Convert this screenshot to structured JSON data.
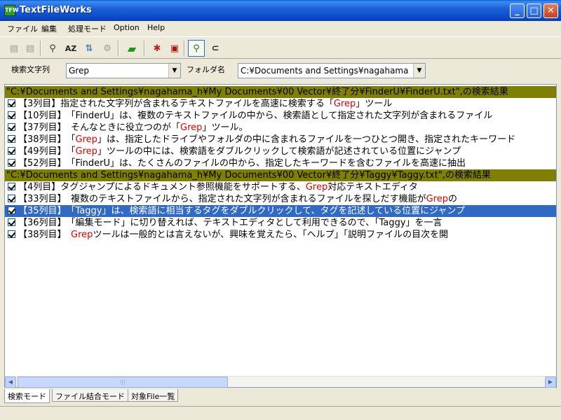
{
  "window": {
    "title": "TextFileWorks",
    "app_icon_text": "TFW",
    "minimize_label": "_",
    "maximize_label": "□",
    "close_label": "✕"
  },
  "menu": [
    "ファイル",
    "編集",
    "処理モード",
    "Option",
    "Help"
  ],
  "toolbar": {
    "icons": [
      "new-file-icon",
      "save-icon",
      "search-person-icon",
      "sort-az-icon",
      "replace-icon",
      "settings-icon",
      "open-folder-icon",
      "color-mark-icon",
      "red-mark-icon",
      "grep-search-icon",
      "paperclip-icon"
    ],
    "az_label": "AZ"
  },
  "search": {
    "label": "検索文字列",
    "value": "Grep",
    "folder_label": "フォルダ名",
    "folder_value": "C:¥Documents and Settings¥nagahama"
  },
  "results": [
    {
      "type": "file",
      "text": "\"C:¥Documents and Settings¥nagahama_h¥My Documents¥00 Vector¥終了分¥FinderU¥FinderU.txt\",の検索結果"
    },
    {
      "type": "match",
      "pre": "【3列目】指定された文字列が含まれるテキストファイルを高速に検索する「",
      "hit": "Grep",
      "post": "」ツール"
    },
    {
      "type": "match",
      "pre": "【10列目】　「FinderU」は、複数のテキストファイルの中から、検索語として指定された文字列が含まれるファイル",
      "hit": "",
      "post": ""
    },
    {
      "type": "match",
      "pre": "【37列目】　そんなときに役立つのが「",
      "hit": "Grep",
      "post": "」ツール。"
    },
    {
      "type": "match",
      "pre": "【38列目】　「",
      "hit": "Grep",
      "post": "」は、指定したドライブやフォルダの中に含まれるファイルを一つひとつ開き、指定されたキーワード"
    },
    {
      "type": "match",
      "pre": "【49列目】　「",
      "hit": "Grep",
      "post": "」ツールの中には、検索語をダブルクリックして検索語が記述されている位置にジャンプ"
    },
    {
      "type": "match",
      "pre": "【52列目】　「FinderU」は、たくさんのファイルの中から、指定したキーワードを含むファイルを高速に抽出",
      "hit": "",
      "post": ""
    },
    {
      "type": "file",
      "text": "\"C:¥Documents and Settings¥nagahama_h¥My Documents¥00 Vector¥終了分¥Taggy¥Taggy.txt\",の検索結果"
    },
    {
      "type": "match",
      "pre": "【4列目】タグジャンプによるドキュメント参照機能をサポートする、",
      "hit": "Grep",
      "post": "対応テキストエディタ"
    },
    {
      "type": "match",
      "pre": "【33列目】　複数のテキストファイルから、指定された文字列が含まれるファイルを探しだす機能が",
      "hit": "Grep",
      "post": "の"
    },
    {
      "type": "match",
      "selected": true,
      "pre": "【35列目】　「Taggy」は、検索語に相当するタグをダブルクリックして、タグを記述している位置にジャンプ",
      "hit": "",
      "post": ""
    },
    {
      "type": "match",
      "pre": "【36列目】　「編集モード」に切り替えれば、テキストエディタとして利用できるので、「Taggy」を一言",
      "hit": "",
      "post": ""
    },
    {
      "type": "match",
      "pre": "【38列目】　",
      "hit": "Grep",
      "post": "ツールは一般的とは言えないが、興味を覚えたら、「ヘルプ」「説明ファイルの目次を開"
    }
  ],
  "tabs": [
    "検索モード",
    "ファイル結合モード",
    "対象File一覧"
  ],
  "colors": {
    "file_header_bg": "#808000",
    "selection_bg": "#316ac5",
    "hit_text": "#e00000"
  }
}
